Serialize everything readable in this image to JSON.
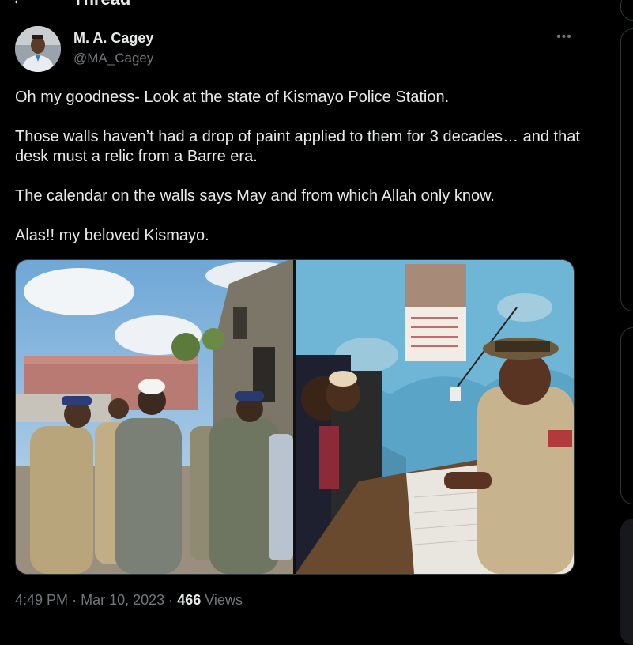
{
  "header": {
    "title": "Thread",
    "back_icon": "back-arrow-icon"
  },
  "tweet": {
    "author_name": "M. A. Cagey",
    "handle": "@MA_Cagey",
    "more_icon": "more-horizontal-icon",
    "text": [
      "Oh my goodness- Look at the state of Kismayo Police Station.",
      "Those walls haven’t had a drop of paint applied to them for 3 decades… and that desk must a relic from a Barre era.",
      "The calendar on the walls says May and from which Allah only know.",
      "Alas!! my beloved Kismayo."
    ],
    "time": "4:49 PM",
    "date": "Mar 10, 2023",
    "separator": "·",
    "views_count": "466",
    "views_label": "Views"
  },
  "media": [
    {
      "kind": "photo",
      "subject": "officials walking outside police station"
    },
    {
      "kind": "photo",
      "subject": "officer writing at old desk"
    }
  ],
  "colors": {
    "background": "#000000",
    "text": "#e7e9ea",
    "muted": "#71767b",
    "border": "#2f3336"
  }
}
